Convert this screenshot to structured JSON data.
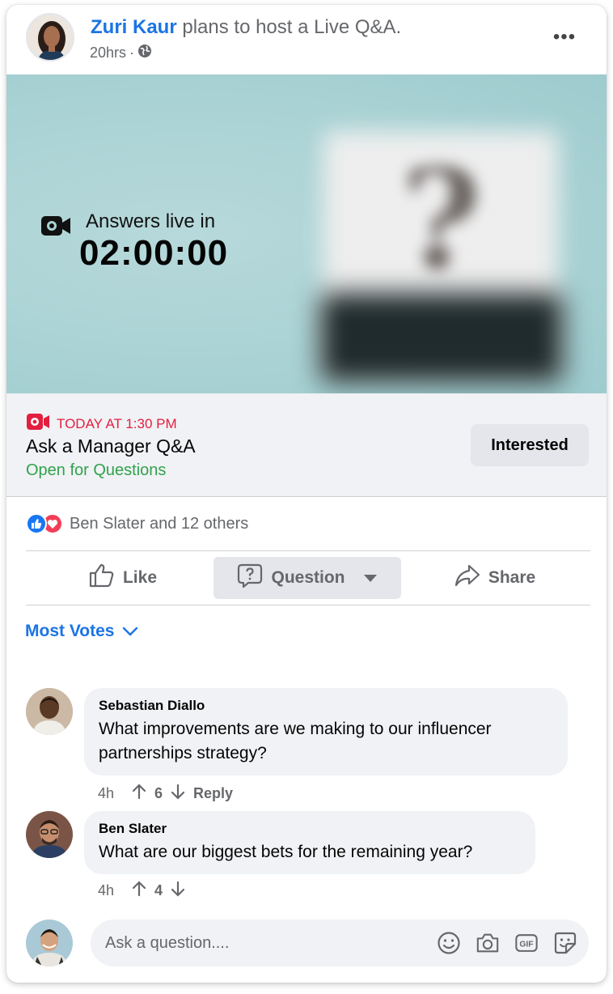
{
  "post": {
    "author": "Zuri Kaur",
    "action": "plans to host a Live Q&A.",
    "time": "20hrs",
    "audience_icon": "globe-icon",
    "more_icon": "more-options-icon"
  },
  "banner": {
    "label": "Answers live in",
    "countdown": "02:00:00",
    "icon": "video-camera-icon"
  },
  "event": {
    "date": "TODAY AT 1:30 PM",
    "title": "Ask a Manager Q&A",
    "status": "Open for Questions",
    "interested_label": "Interested"
  },
  "reactions": {
    "summary": "Ben Slater and 12 others"
  },
  "actions": {
    "like": "Like",
    "question": "Question",
    "share": "Share"
  },
  "sort": {
    "label": "Most Votes"
  },
  "comments": [
    {
      "author": "Sebastian Diallo",
      "text": "What improvements are we making to our influencer partnerships strategy?",
      "time": "4h",
      "votes": "6",
      "reply": "Reply"
    },
    {
      "author": "Ben Slater",
      "text": "What are our biggest bets for the remaining year?",
      "time": "4h",
      "votes": "4"
    }
  ],
  "composer": {
    "placeholder": "Ask a question...."
  },
  "colors": {
    "brand_blue": "#1b74e4",
    "live_red": "#e41e3f",
    "open_green": "#31a24c",
    "banner_teal": "#a9d2d4"
  }
}
